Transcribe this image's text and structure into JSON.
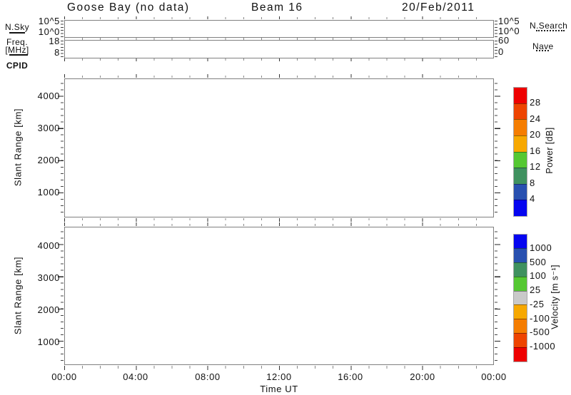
{
  "header": {
    "station": "Goose Bay (no data)",
    "beam": "Beam 16",
    "date": "20/Feb/2011"
  },
  "noise_strip": {
    "left_label": "N.Sky",
    "left_tick_top": "10^5",
    "left_tick_bottom": "10^0",
    "right_tick_top": "10^5",
    "right_tick_bottom": "10^0",
    "legend_right": "N.Search"
  },
  "freq_strip": {
    "left_label_top": "Freq.",
    "left_label_bottom": "[MHz]",
    "left_tick_top": "18",
    "left_tick_bottom": "8",
    "right_tick_top": "60",
    "right_tick_bottom": "0",
    "legend_right": "Nave"
  },
  "cpid_label": "CPID",
  "xaxis": {
    "label": "Time UT",
    "ticks": [
      "00:00",
      "04:00",
      "08:00",
      "12:00",
      "16:00",
      "20:00",
      "00:00"
    ]
  },
  "power_panel": {
    "ylabel": "Slant Range [km]",
    "yticks": [
      "4000",
      "3000",
      "2000",
      "1000"
    ]
  },
  "velocity_panel": {
    "ylabel": "Slant Range [km]",
    "yticks": [
      "4000",
      "3000",
      "2000",
      "1000"
    ]
  },
  "power_colorbar": {
    "title": "Power [dB]",
    "tick_labels": [
      "28",
      "24",
      "20",
      "16",
      "12",
      "8",
      "4"
    ],
    "colors_top_to_bottom": [
      "#ee0000",
      "#ee4400",
      "#f57d00",
      "#f7a800",
      "#55c832",
      "#3f915f",
      "#2850b0",
      "#0505f0"
    ]
  },
  "velocity_colorbar": {
    "title": "Velocity [m s⁻¹]",
    "tick_labels": [
      "1000",
      "500",
      "100",
      "25",
      "-25",
      "-100",
      "-500",
      "-1000"
    ],
    "colors_top_to_bottom": [
      "#0505f0",
      "#2850b0",
      "#3f915f",
      "#55c832",
      "#c9c9c9",
      "#f7a800",
      "#f57d00",
      "#ee4400",
      "#ee0000"
    ]
  },
  "chart_data": [
    {
      "type": "line",
      "title": "Noise panel (sky noise / search noise)",
      "x_range": [
        "00:00",
        "24:00"
      ],
      "y_scale": "log",
      "y_ticks_left": [
        "10^0",
        "10^5"
      ],
      "y_ticks_right": [
        "10^0",
        "10^5"
      ],
      "series": [
        {
          "name": "N.Sky",
          "line_style": "solid",
          "values": []
        },
        {
          "name": "N.Search",
          "line_style": "dotted",
          "values": []
        }
      ],
      "note": "no data plotted"
    },
    {
      "type": "line",
      "title": "Frequency / Nave panel",
      "x_range": [
        "00:00",
        "24:00"
      ],
      "y_ticks_left": [
        8,
        18
      ],
      "ylabel_left": "Freq. [MHz]",
      "y_ticks_right": [
        0,
        60
      ],
      "ylabel_right": "Nave",
      "series": [
        {
          "name": "Freq. [MHz]",
          "line_style": "solid",
          "values": []
        },
        {
          "name": "Nave",
          "line_style": "dotted",
          "values": []
        }
      ],
      "note": "no data plotted"
    },
    {
      "type": "heatmap",
      "title": "Power range-time panel",
      "xlabel": "Time UT",
      "x_ticks": [
        "00:00",
        "04:00",
        "08:00",
        "12:00",
        "16:00",
        "20:00",
        "00:00"
      ],
      "ylabel": "Slant Range [km]",
      "ylim": [
        180,
        4500
      ],
      "y_ticks": [
        1000,
        2000,
        3000,
        4000
      ],
      "colorbar": {
        "label": "Power [dB]",
        "boundaries": [
          4,
          8,
          12,
          16,
          20,
          24,
          28
        ],
        "colors_bottom_to_top": [
          "#0505f0",
          "#2850b0",
          "#3f915f",
          "#55c832",
          "#f7a800",
          "#f57d00",
          "#ee4400",
          "#ee0000"
        ]
      },
      "values": [],
      "note": "no data plotted (empty panel)"
    },
    {
      "type": "heatmap",
      "title": "Velocity range-time panel",
      "xlabel": "Time UT",
      "x_ticks": [
        "00:00",
        "04:00",
        "08:00",
        "12:00",
        "16:00",
        "20:00",
        "00:00"
      ],
      "ylabel": "Slant Range [km]",
      "ylim": [
        180,
        4500
      ],
      "y_ticks": [
        1000,
        2000,
        3000,
        4000
      ],
      "colorbar": {
        "label": "Velocity [m s^-1]",
        "boundaries": [
          -1000,
          -500,
          -100,
          -25,
          25,
          100,
          500,
          1000
        ],
        "colors_bottom_to_top": [
          "#ee0000",
          "#ee4400",
          "#f57d00",
          "#f7a800",
          "#c9c9c9",
          "#55c832",
          "#3f915f",
          "#2850b0",
          "#0505f0"
        ]
      },
      "values": [],
      "note": "no data plotted (empty panel)"
    }
  ]
}
